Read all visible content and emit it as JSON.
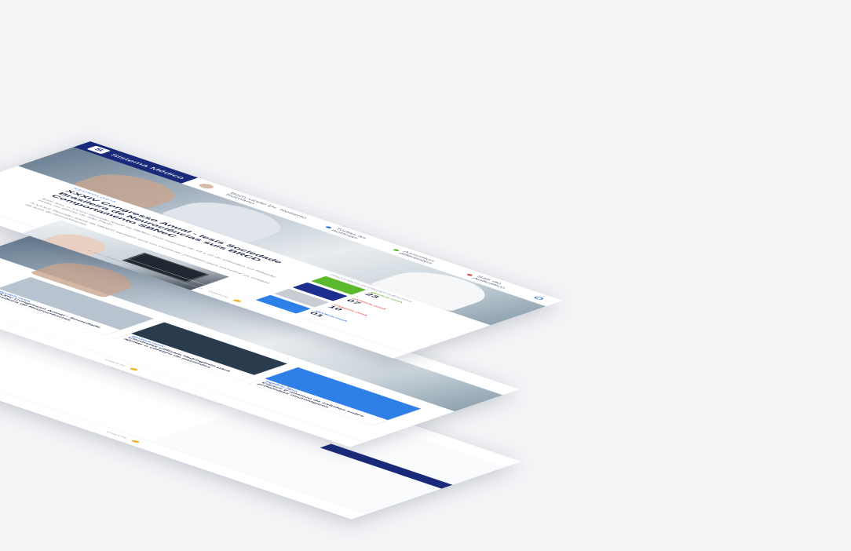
{
  "brand": {
    "name": "Sistema Médico"
  },
  "topnav": {
    "greeting": "Bem-vindo Dr. Roberto Romano",
    "items": [
      "Todas as notícias",
      "Assuntos diferentes",
      "Sair do Aplicativo"
    ]
  },
  "article": {
    "kicker": "NEUROLOGIA",
    "title": "XXXIV Congresso Anual - Iesis Sociedade Brasileira de Neurociências suis BRCD Comportamento SBNeC",
    "para1": "Este ano, o XXXIV Reunião Anual da SBNeC será realizado de 19 a 22 de setembro em Ribeirão Preto, no interior de São Paulo.",
    "para2": "A XXXIV Reunião Anual da SBNeC também será um excelente momento para encontrar os colegas da área de neurociências.",
    "para3": "Este ano, o XXXIV Reunião Anual da SBNeC será realizado de 19 a 22 de setembro em Ribeirão Preto."
  },
  "sidebar": {
    "title": "Próximos acontecimentos",
    "cards": [
      {
        "cat": "NEUROLOGIA",
        "day": "23",
        "color": "#5cb82c"
      },
      {
        "cat": "CARDIOLOGIA",
        "day": "07",
        "color": "#1d2f8e"
      },
      {
        "cat": "CARDIOLOGIA",
        "day": "10",
        "color": "#c9ccd3"
      },
      {
        "cat": "NEUROLOGIA",
        "day": "01",
        "color": "#2f7fe8"
      }
    ]
  },
  "grid": {
    "tiles": [
      {
        "cat": "NEUROLOGIA",
        "title": "XXXIV Congresso Anual - Sociedade Brasileira de Neurociências",
        "color": "#b7c3cf"
      },
      {
        "cat": "NEUROLOGIA",
        "title": "Cientistas utilizam Hidrogênio para ajudar o cérebro de pacientes",
        "color": "#2a3b4e"
      },
      {
        "cat": "NEUROLOGIA",
        "title": "Cresce o número de estudos sobre problemas neurológicos",
        "color": "#2f7fe8"
      }
    ]
  },
  "footer": {
    "text": "© 2017 Sistema Médico - Todos os direitos reservados",
    "logo": "VISENTE"
  }
}
